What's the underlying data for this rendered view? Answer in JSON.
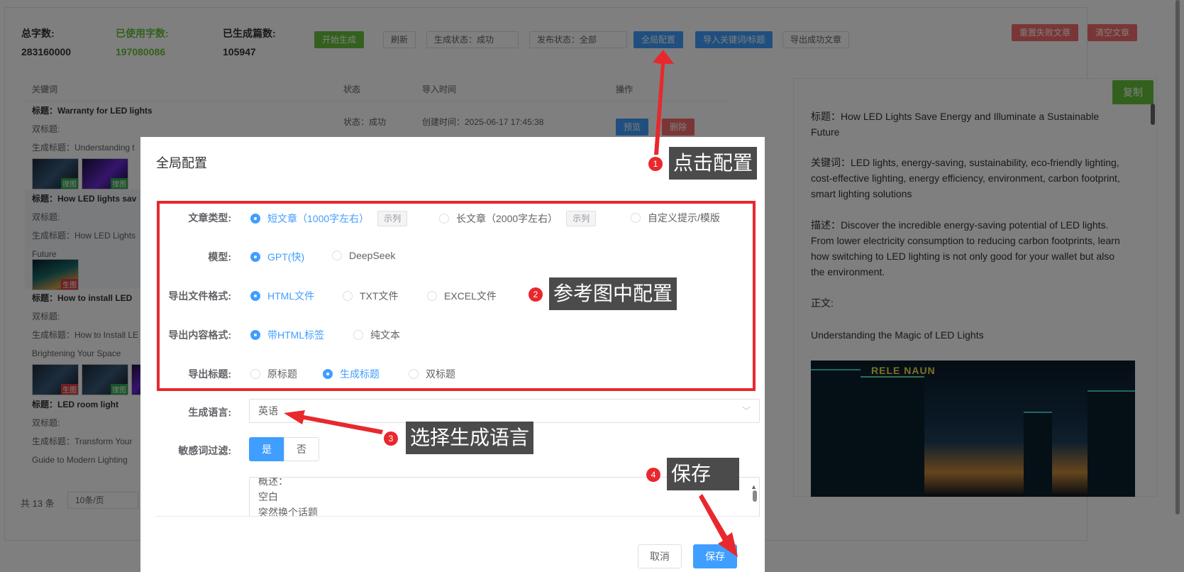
{
  "stats": [
    {
      "label": "总字数:",
      "value": "283160000"
    },
    {
      "label": "已使用字数:",
      "value": "197080086"
    },
    {
      "label": "已生成篇数:",
      "value": "105947"
    }
  ],
  "toolbar": {
    "start": "开始生成",
    "refresh": "刷新",
    "gen_status": "生成状态：成功",
    "pub_status": "发布状态：全部",
    "global_config": "全局配置",
    "import": "导入关键词/标题",
    "export": "导出成功文章",
    "reset_failed": "重置失败文章",
    "clear": "清空文章"
  },
  "table": {
    "headers": [
      "关键词",
      "状态",
      "导入时间",
      "操作"
    ],
    "rows": [
      {
        "title": "标题：Warranty for LED lights",
        "double": "双标题:",
        "gen": "生成标题：Understanding t",
        "status": "状态：成功",
        "created": "创建时间：2025-06-17 17:45:38",
        "preview": "预览",
        "delete": "删除",
        "tag1": "搜图",
        "tag2": "搜图"
      },
      {
        "title": "标题：How LED lights sav",
        "double": "双标题:",
        "gen": "生成标题：How LED Lights",
        "cont": "Future",
        "tag1": "生图"
      },
      {
        "title": "标题：How to install LED",
        "double": "双标题:",
        "gen": "生成标题：How to Install LE",
        "cont": "Brightening Your Space",
        "tag1": "生图",
        "tag2": "搜图"
      },
      {
        "title": "标题：LED room light",
        "double": "双标题:",
        "gen": "生成标题：Transform Your",
        "cont": "Guide to Modern Lighting"
      }
    ],
    "total": "共 13 条",
    "page_size": "10条/页"
  },
  "preview": {
    "copy": "复制",
    "title": "标题：How LED Lights Save Energy and Illuminate a Sustainable Future",
    "keywords": "关键词：LED lights, energy-saving, sustainability, eco-friendly lighting, cost-effective lighting, energy efficiency, environment, carbon footprint, smart lighting solutions",
    "desc": "描述：Discover the incredible energy-saving potential of LED lights. From lower electricity consumption to reducing carbon footprints, learn how switching to LED lighting is not only good for your wallet but also the environment.",
    "body_label": "正文:",
    "heading": "Understanding the Magic of LED Lights",
    "image_sign": "RELE NAUN"
  },
  "modal": {
    "title": "全局配置",
    "rows": [
      {
        "label": "文章类型:",
        "options": [
          {
            "text": "短文章（1000字左右）",
            "checked": true,
            "tag": "示列"
          },
          {
            "text": "长文章（2000字左右）",
            "checked": false,
            "tag": "示列"
          },
          {
            "text": "自定义提示/模版",
            "checked": false
          }
        ]
      },
      {
        "label": "模型:",
        "options": [
          {
            "text": "GPT(快)",
            "checked": true
          },
          {
            "text": "DeepSeek",
            "checked": false
          }
        ]
      },
      {
        "label": "导出文件格式:",
        "options": [
          {
            "text": "HTML文件",
            "checked": true
          },
          {
            "text": "TXT文件",
            "checked": false
          },
          {
            "text": "EXCEL文件",
            "checked": false
          }
        ]
      },
      {
        "label": "导出内容格式:",
        "options": [
          {
            "text": "带HTML标签",
            "checked": true
          },
          {
            "text": "纯文本",
            "checked": false
          }
        ]
      },
      {
        "label": "导出标题:",
        "options": [
          {
            "text": "原标题",
            "checked": false
          },
          {
            "text": "生成标题",
            "checked": true
          },
          {
            "text": "双标题",
            "checked": false
          }
        ]
      }
    ],
    "language_label": "生成语言:",
    "language_value": "英语",
    "filter_label": "敏感词过滤:",
    "filter_yes": "是",
    "filter_no": "否",
    "prompt_lines": [
      "概述：",
      "空白",
      "突然换个话题"
    ],
    "cancel": "取消",
    "save": "保存"
  },
  "annotations": [
    {
      "num": "1",
      "text": "点击配置"
    },
    {
      "num": "2",
      "text": "参考图中配置"
    },
    {
      "num": "3",
      "text": "选择生成语言"
    },
    {
      "num": "4",
      "text": "保存"
    }
  ],
  "colors": {
    "primary": "#409eff",
    "success": "#67c23a",
    "danger": "#f56c6c",
    "annotation": "#e8282d"
  }
}
